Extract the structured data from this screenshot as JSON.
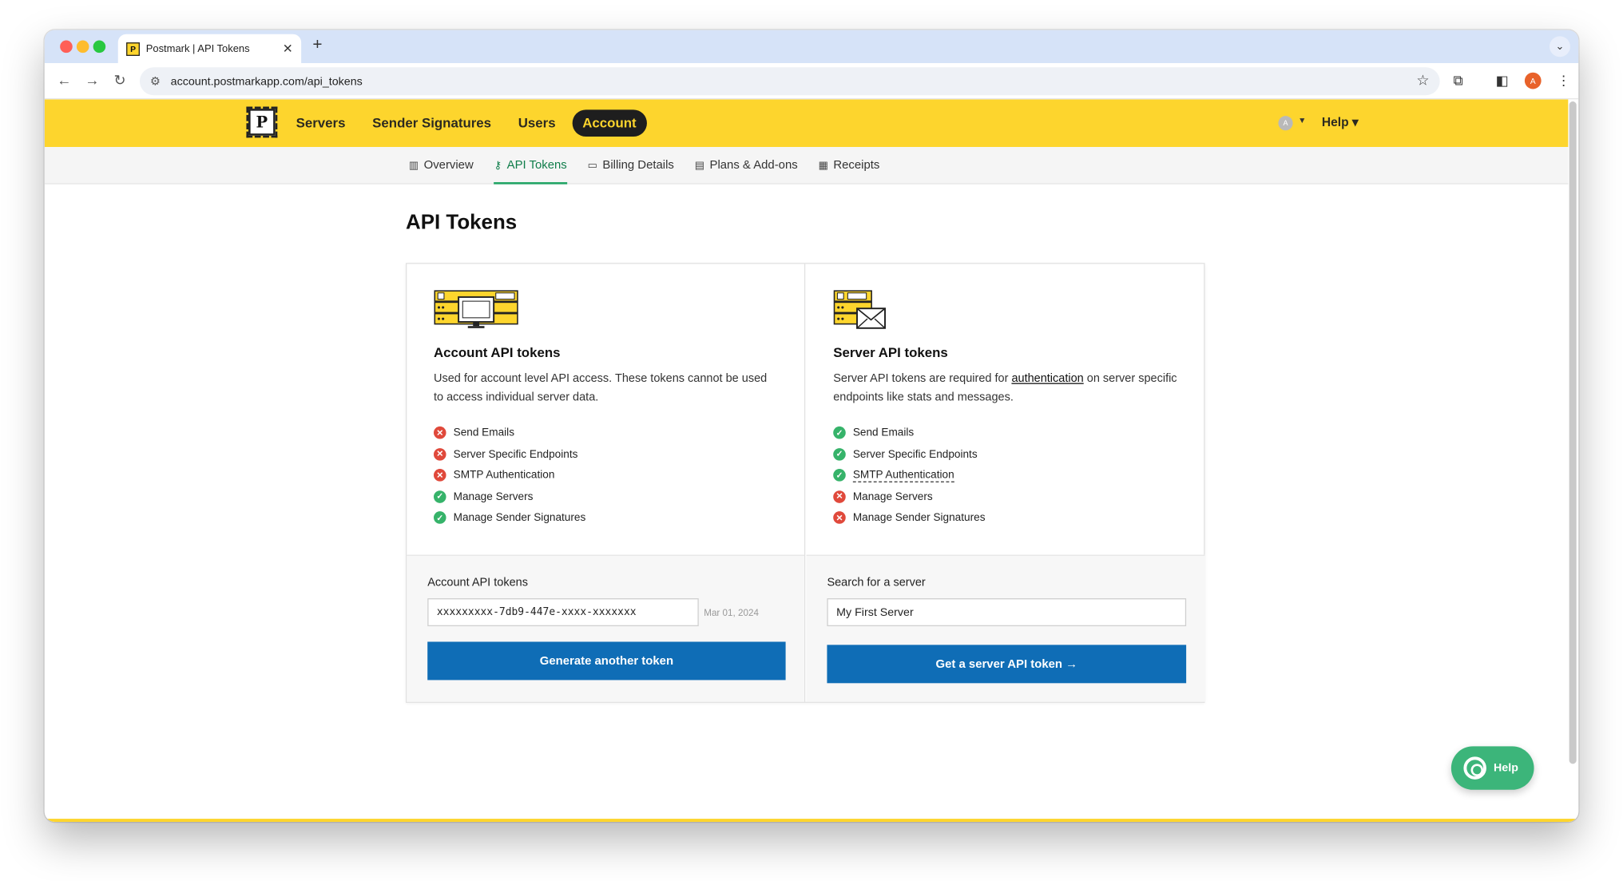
{
  "browser": {
    "tab_title": "Postmark | API Tokens",
    "tab_favicon": "P",
    "url": "account.postmarkapp.com/api_tokens",
    "profile_initial": "A"
  },
  "topnav": {
    "logo": "P",
    "items": [
      "Servers",
      "Sender Signatures",
      "Users",
      "Account"
    ],
    "active": "Account",
    "avatar_initial": "A",
    "help": "Help"
  },
  "subnav": {
    "items": [
      {
        "icon": "building-icon",
        "label": "Overview"
      },
      {
        "icon": "key-icon",
        "label": "API Tokens"
      },
      {
        "icon": "credit-card-icon",
        "label": "Billing Details"
      },
      {
        "icon": "ticket-icon",
        "label": "Plans & Add-ons"
      },
      {
        "icon": "receipt-icon",
        "label": "Receipts"
      }
    ],
    "active": "API Tokens"
  },
  "page": {
    "title": "API Tokens"
  },
  "account_tokens": {
    "title": "Account API tokens",
    "description": "Used for account level API access. These tokens cannot be used to access individual server data.",
    "features": [
      {
        "label": "Send Emails",
        "allowed": false
      },
      {
        "label": "Server Specific Endpoints",
        "allowed": false
      },
      {
        "label": "SMTP Authentication",
        "allowed": false
      },
      {
        "label": "Manage Servers",
        "allowed": true
      },
      {
        "label": "Manage Sender Signatures",
        "allowed": true
      }
    ],
    "field_label": "Account API tokens",
    "token_value": "xxxxxxxxx-7db9-447e-xxxx-xxxxxxx",
    "token_date": "Mar 01, 2024",
    "button_label": "Generate another token"
  },
  "server_tokens": {
    "title": "Server API tokens",
    "description_before": "Server API tokens are required for ",
    "description_link": "authentication",
    "description_after": " on server specific endpoints like stats and messages.",
    "features": [
      {
        "label": "Send Emails",
        "allowed": true
      },
      {
        "label": "Server Specific Endpoints",
        "allowed": true
      },
      {
        "label": "SMTP Authentication",
        "allowed": true
      },
      {
        "label": "Manage Servers",
        "allowed": false
      },
      {
        "label": "Manage Sender Signatures",
        "allowed": false
      }
    ],
    "field_label": "Search for a server",
    "server_value": "My First Server",
    "button_label": "Get a server API token →"
  },
  "help_widget": {
    "label": "Help"
  },
  "colors": {
    "brand_yellow": "#fdd52d",
    "primary_blue": "#0f6db6",
    "success_green": "#36b36a",
    "error_red": "#e0493b"
  }
}
